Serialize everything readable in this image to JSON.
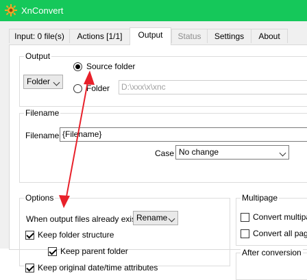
{
  "window": {
    "title": "XnConvert",
    "titlebar_color": "#15c85a",
    "icon": "xnconvert-logo-icon"
  },
  "tabs": [
    {
      "label": "Input: 0 file(s)",
      "state": "normal"
    },
    {
      "label": "Actions [1/1]",
      "state": "normal"
    },
    {
      "label": "Output",
      "state": "active"
    },
    {
      "label": "Status",
      "state": "disabled"
    },
    {
      "label": "Settings",
      "state": "normal"
    },
    {
      "label": "About",
      "state": "normal"
    }
  ],
  "output_group": {
    "title": "Output",
    "type_value": "Folder",
    "source_folder_label": "Source folder",
    "source_folder_selected": true,
    "folder_label": "Folder",
    "folder_selected": false,
    "folder_path": "D:\\xxx\\x\\xnc"
  },
  "filename_group": {
    "title": "Filename",
    "filename_label": "Filename",
    "filename_value": "{Filename}",
    "case_label": "Case",
    "case_value": "No change"
  },
  "options_group": {
    "title": "Options",
    "exists_label": "When output files already exist",
    "exists_value": "Rename",
    "keep_folder_structure": {
      "label": "Keep folder structure",
      "checked": true
    },
    "keep_parent_folder": {
      "label": "Keep parent folder",
      "checked": true
    },
    "keep_original_date": {
      "label": "Keep original date/time attributes",
      "checked": true
    }
  },
  "multipage_group": {
    "title": "Multipage",
    "convert_multipage": {
      "label": "Convert multipag",
      "checked": false
    },
    "convert_all_pages": {
      "label": "Convert all pages",
      "checked": false
    }
  },
  "after_conversion_group": {
    "title": "After conversion"
  },
  "annotation": {
    "arrow_color": "#e8202a"
  }
}
